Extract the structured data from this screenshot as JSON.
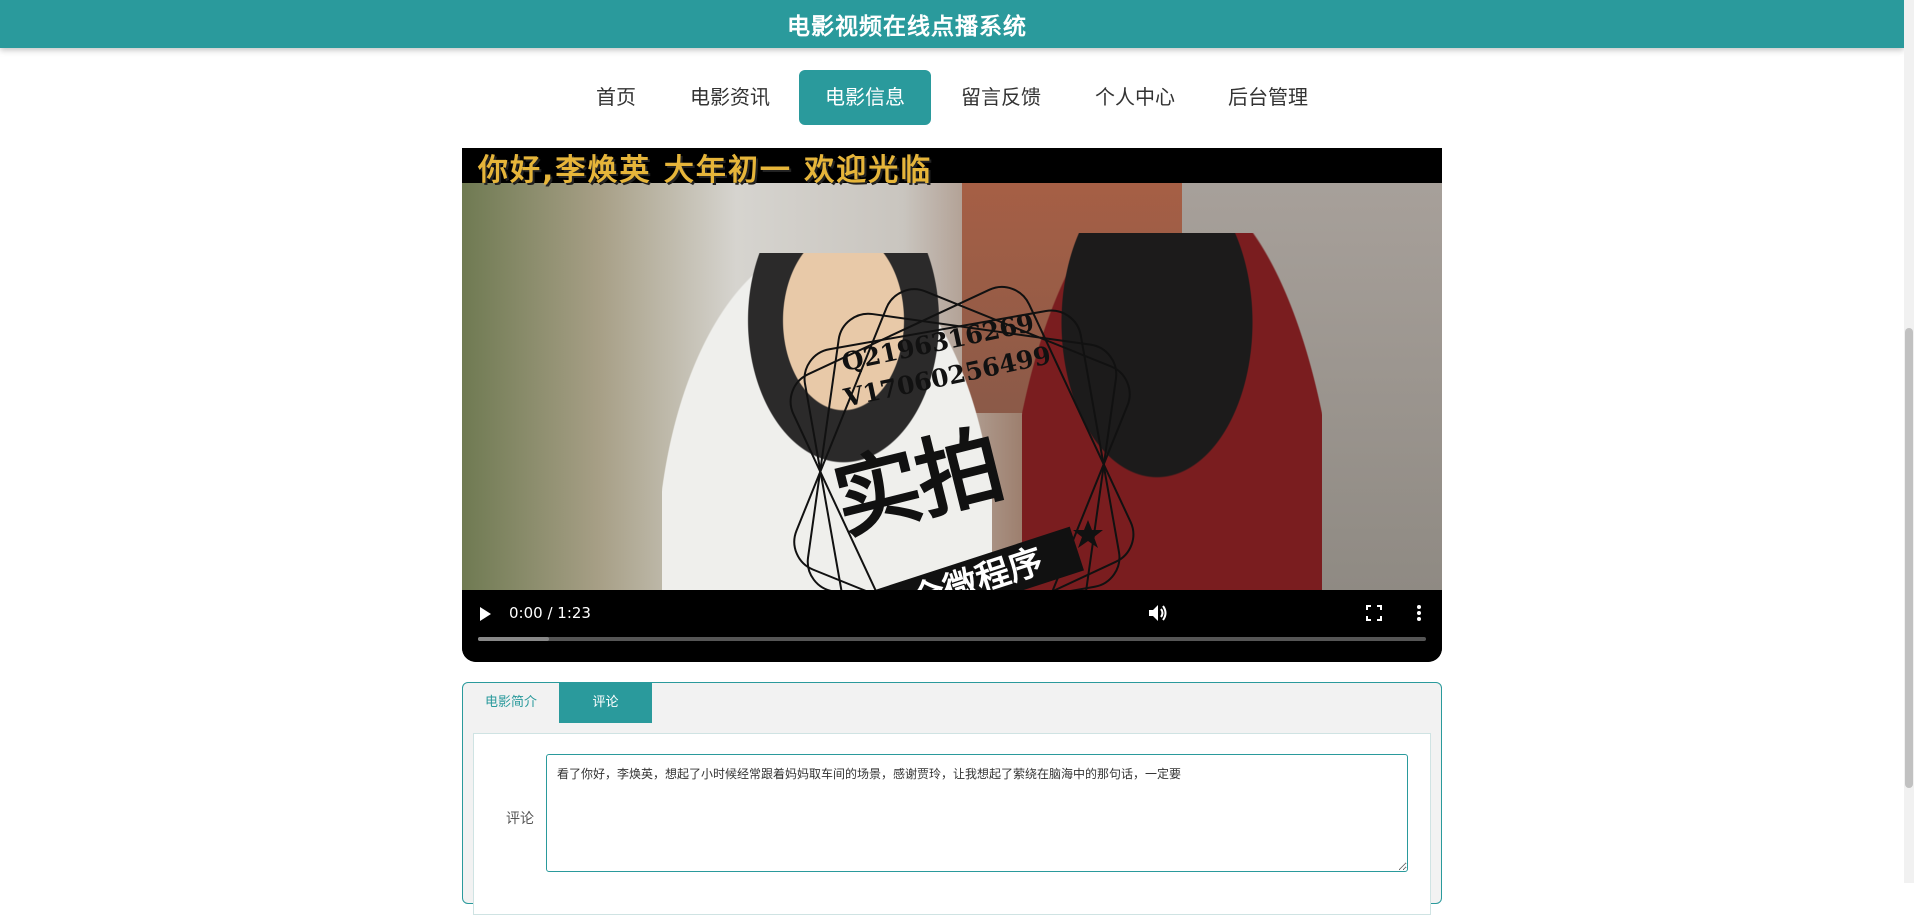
{
  "header": {
    "title": "电影视频在线点播系统"
  },
  "nav": {
    "items": [
      {
        "label": "首页"
      },
      {
        "label": "电影资讯"
      },
      {
        "label": "电影信息"
      },
      {
        "label": "留言反馈"
      },
      {
        "label": "个人中心"
      },
      {
        "label": "后台管理"
      }
    ],
    "active_index": 2
  },
  "video": {
    "caption": "你好,李焕英  大年初一 欢迎光临",
    "time": "0:00 / 1:23",
    "progress_fraction": 0.0,
    "buffered_fraction": 0.075,
    "watermark": {
      "contact_q": "Q2196316269",
      "contact_v": "V17060256499",
      "stamp_main": "实拍",
      "stamp_ribbon": "全微程序"
    },
    "icons": {
      "play": "play-icon",
      "volume": "volume-icon",
      "fullscreen": "fullscreen-icon",
      "more": "more-vertical-icon"
    }
  },
  "tabs": {
    "items": [
      {
        "label": "电影简介"
      },
      {
        "label": "评论"
      }
    ],
    "active_index": 1
  },
  "comment": {
    "label": "评论",
    "value": "看了你好，李焕英，想起了小时候经常跟着妈妈取车间的场景，感谢贾玲，让我想起了萦绕在脑海中的那句话，一定要"
  },
  "colors": {
    "accent": "#2a9a9c",
    "header_bg": "#2a9a9c"
  }
}
